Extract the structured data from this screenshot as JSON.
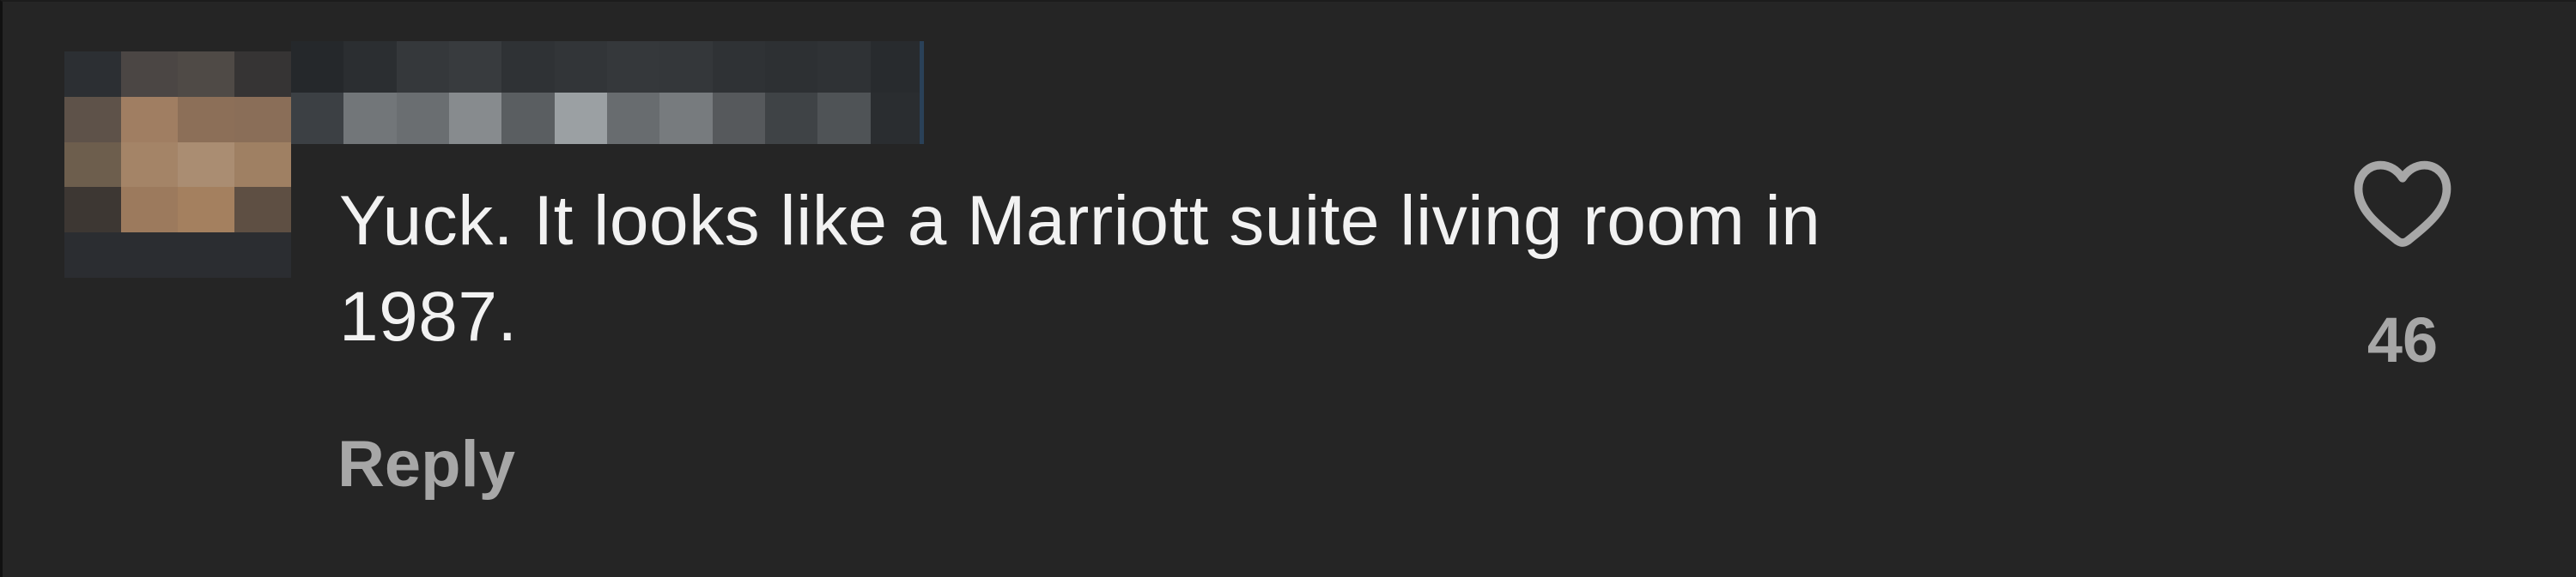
{
  "comment": {
    "text": "Yuck. It looks like a Marriott suite living room in\n1987.",
    "reply_label": "Reply",
    "like_count": "46"
  },
  "icons": {
    "like": "heart-outline-icon"
  },
  "colors": {
    "background": "#252525",
    "text": "#f2f2f2",
    "muted": "#a7a7a7"
  },
  "avatar_pixels": [
    "#2c2f33",
    "#4b4644",
    "#4f4a46",
    "#363434",
    "#5e5249",
    "#a07e62",
    "#8c6f58",
    "#8a6e58",
    "#6d5e4d",
    "#a48467",
    "#aa8d72",
    "#9f8063",
    "#3d3733",
    "#9c7a5d",
    "#a4805f",
    "#5e4f43",
    "#2b2d31",
    "#2b2d31",
    "#2b2d31",
    "#2b2d31"
  ],
  "username_pixels": [
    "#25282b",
    "#2b2e31",
    "#35383b",
    "#383b3e",
    "#2f3235",
    "#323538",
    "#35383b",
    "#34373a",
    "#2f3235",
    "#2d3033",
    "#2f3235",
    "#282b2e",
    "#3c4044",
    "#727679",
    "#6a6e71",
    "#878b8e",
    "#5a5e61",
    "#9ba0a3",
    "#686c6f",
    "#777b7e",
    "#56595c",
    "#3f4346",
    "#4f5356",
    "#2a2d30"
  ]
}
